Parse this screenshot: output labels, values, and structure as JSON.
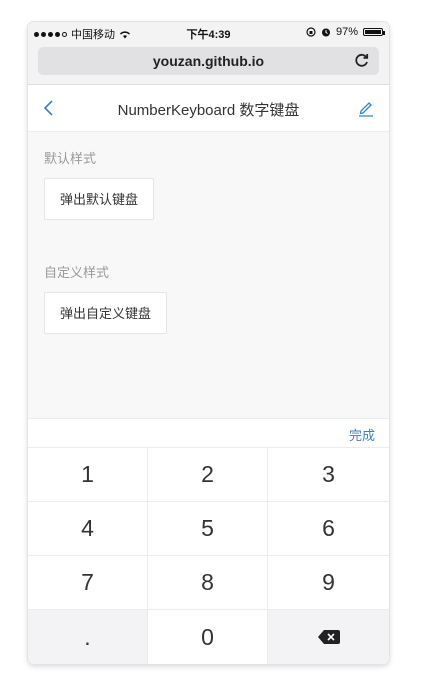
{
  "status_bar": {
    "carrier": "中国移动",
    "time": "下午4:39",
    "battery": "97%",
    "battery_level": 0.97
  },
  "address_bar": {
    "url": "youzan.github.io"
  },
  "nav": {
    "title": "NumberKeyboard 数字键盘"
  },
  "sections": [
    {
      "title": "默认样式",
      "button": "弹出默认键盘"
    },
    {
      "title": "自定义样式",
      "button": "弹出自定义键盘"
    }
  ],
  "keyboard": {
    "done_label": "完成",
    "keys": [
      "1",
      "2",
      "3",
      "4",
      "5",
      "6",
      "7",
      "8",
      "9",
      ".",
      "0"
    ]
  },
  "icons": {
    "back": "chevron-left-icon",
    "edit": "pencil-icon",
    "reload": "reload-icon",
    "wifi": "wifi-icon",
    "lock": "orientation-lock-icon",
    "alarm": "alarm-icon",
    "delete": "backspace-icon"
  },
  "colors": {
    "accent": "#3b82c4"
  }
}
